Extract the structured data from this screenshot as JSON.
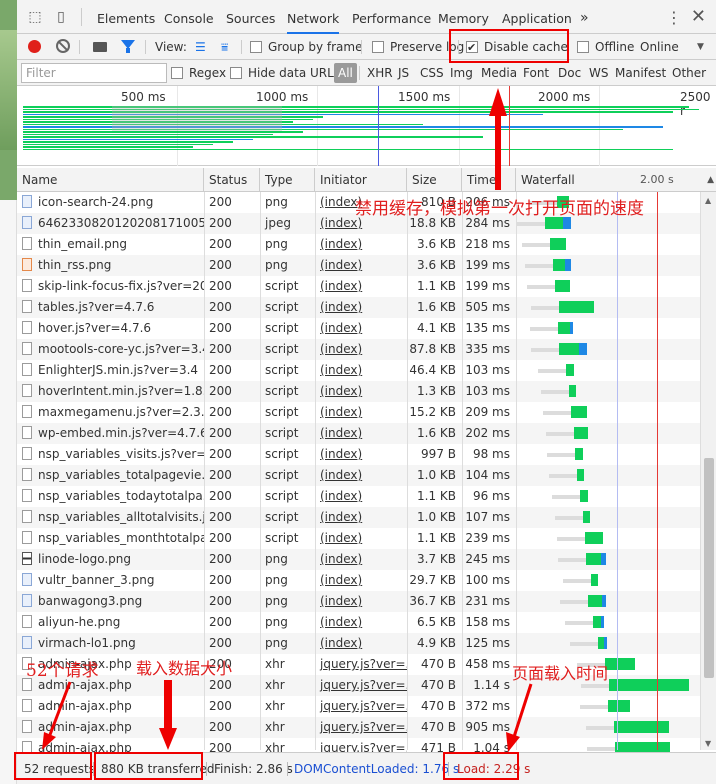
{
  "tabbar": {
    "tabs": [
      "Elements",
      "Console",
      "Sources",
      "Network",
      "Performance",
      "Memory",
      "Application"
    ],
    "active_tab": "Network",
    "more_icon": "»",
    "kebab_icon": "⋮",
    "close_icon": "✕"
  },
  "toolbar": {
    "view_label": "View:",
    "group_by_frame": "Group by frame",
    "preserve_log": "Preserve log",
    "disable_cache": "Disable cache",
    "offline": "Offline",
    "throttle": "Online"
  },
  "filterbar": {
    "filter_placeholder": "Filter",
    "regex": "Regex",
    "hide_data_urls": "Hide data URLs",
    "types": [
      "All",
      "XHR",
      "JS",
      "CSS",
      "Img",
      "Media",
      "Font",
      "Doc",
      "WS",
      "Manifest",
      "Other"
    ]
  },
  "overview": {
    "ticks": [
      "500 ms",
      "1000 ms",
      "1500 ms",
      "2000 ms",
      "2500 r"
    ]
  },
  "table": {
    "headers": [
      "Name",
      "Status",
      "Type",
      "Initiator",
      "Size",
      "Time",
      "Waterfall"
    ],
    "waterfall_tick": "2.00 s",
    "rows": [
      {
        "name": "icon-search-24.png",
        "status": "200",
        "type": "png",
        "initiator": "(index)",
        "size": "810 B",
        "time": "206 ms",
        "icon": "img"
      },
      {
        "name": "6462330820120208171005...",
        "status": "200",
        "type": "jpeg",
        "initiator": "(index)",
        "size": "18.8 KB",
        "time": "284 ms",
        "icon": "img"
      },
      {
        "name": "thin_email.png",
        "status": "200",
        "type": "png",
        "initiator": "(index)",
        "size": "3.6 KB",
        "time": "218 ms",
        "icon": "doc"
      },
      {
        "name": "thin_rss.png",
        "status": "200",
        "type": "png",
        "initiator": "(index)",
        "size": "3.6 KB",
        "time": "199 ms",
        "icon": "rss"
      },
      {
        "name": "skip-link-focus-fix.js?ver=20...",
        "status": "200",
        "type": "script",
        "initiator": "(index)",
        "size": "1.1 KB",
        "time": "199 ms",
        "icon": "doc"
      },
      {
        "name": "tables.js?ver=4.7.6",
        "status": "200",
        "type": "script",
        "initiator": "(index)",
        "size": "1.6 KB",
        "time": "505 ms",
        "icon": "doc"
      },
      {
        "name": "hover.js?ver=4.7.6",
        "status": "200",
        "type": "script",
        "initiator": "(index)",
        "size": "4.1 KB",
        "time": "135 ms",
        "icon": "doc"
      },
      {
        "name": "mootools-core-yc.js?ver=3.4",
        "status": "200",
        "type": "script",
        "initiator": "(index)",
        "size": "87.8 KB",
        "time": "335 ms",
        "icon": "doc"
      },
      {
        "name": "EnlighterJS.min.js?ver=3.4",
        "status": "200",
        "type": "script",
        "initiator": "(index)",
        "size": "46.4 KB",
        "time": "103 ms",
        "icon": "doc"
      },
      {
        "name": "hoverIntent.min.js?ver=1.8.1",
        "status": "200",
        "type": "script",
        "initiator": "(index)",
        "size": "1.3 KB",
        "time": "103 ms",
        "icon": "doc"
      },
      {
        "name": "maxmegamenu.js?ver=2.3.7.1",
        "status": "200",
        "type": "script",
        "initiator": "(index)",
        "size": "15.2 KB",
        "time": "209 ms",
        "icon": "doc"
      },
      {
        "name": "wp-embed.min.js?ver=4.7.6",
        "status": "200",
        "type": "script",
        "initiator": "(index)",
        "size": "1.6 KB",
        "time": "202 ms",
        "icon": "doc"
      },
      {
        "name": "nsp_variables_visits.js?ver=4...",
        "status": "200",
        "type": "script",
        "initiator": "(index)",
        "size": "997 B",
        "time": "98 ms",
        "icon": "doc"
      },
      {
        "name": "nsp_variables_totalpagevie...",
        "status": "200",
        "type": "script",
        "initiator": "(index)",
        "size": "1.0 KB",
        "time": "104 ms",
        "icon": "doc"
      },
      {
        "name": "nsp_variables_todaytotalpa...",
        "status": "200",
        "type": "script",
        "initiator": "(index)",
        "size": "1.1 KB",
        "time": "96 ms",
        "icon": "doc"
      },
      {
        "name": "nsp_variables_alltotalvisits.js...",
        "status": "200",
        "type": "script",
        "initiator": "(index)",
        "size": "1.0 KB",
        "time": "107 ms",
        "icon": "doc"
      },
      {
        "name": "nsp_variables_monthtotalpa...",
        "status": "200",
        "type": "script",
        "initiator": "(index)",
        "size": "1.1 KB",
        "time": "239 ms",
        "icon": "doc"
      },
      {
        "name": "linode-logo.png",
        "status": "200",
        "type": "png",
        "initiator": "(index)",
        "size": "3.7 KB",
        "time": "245 ms",
        "icon": "logo"
      },
      {
        "name": "vultr_banner_3.png",
        "status": "200",
        "type": "png",
        "initiator": "(index)",
        "size": "29.7 KB",
        "time": "100 ms",
        "icon": "img"
      },
      {
        "name": "banwagong3.png",
        "status": "200",
        "type": "png",
        "initiator": "(index)",
        "size": "36.7 KB",
        "time": "231 ms",
        "icon": "img"
      },
      {
        "name": "aliyun-he.png",
        "status": "200",
        "type": "png",
        "initiator": "(index)",
        "size": "6.5 KB",
        "time": "158 ms",
        "icon": "doc"
      },
      {
        "name": "virmach-lo1.png",
        "status": "200",
        "type": "png",
        "initiator": "(index)",
        "size": "4.9 KB",
        "time": "125 ms",
        "icon": "img"
      },
      {
        "name": "admin-ajax.php",
        "status": "200",
        "type": "xhr",
        "initiator": "jquery.js?ver=...",
        "size": "470 B",
        "time": "458 ms",
        "icon": "doc"
      },
      {
        "name": "admin-ajax.php",
        "status": "200",
        "type": "xhr",
        "initiator": "jquery.js?ver=...",
        "size": "470 B",
        "time": "1.14 s",
        "icon": "doc"
      },
      {
        "name": "admin-ajax.php",
        "status": "200",
        "type": "xhr",
        "initiator": "jquery.js?ver=...",
        "size": "470 B",
        "time": "372 ms",
        "icon": "doc"
      },
      {
        "name": "admin-ajax.php",
        "status": "200",
        "type": "xhr",
        "initiator": "jquery.js?ver=...",
        "size": "470 B",
        "time": "905 ms",
        "icon": "doc"
      },
      {
        "name": "admin-ajax.php",
        "status": "200",
        "type": "xhr",
        "initiator": "jquery.js?ver=...",
        "size": "471 B",
        "time": "1.04 s",
        "icon": "doc"
      }
    ]
  },
  "statusbar": {
    "requests": "52 requests",
    "transferred": "880 KB transferred",
    "finish": "Finish: 2.86 s",
    "dom_content_loaded": "DOMContentLoaded: 1.76 s",
    "load": "Load: 2.29 s"
  },
  "annotations": {
    "disable_cache_note": "禁用缓存，模拟第一次打开页面的速度",
    "requests_note": "52个请求",
    "transferred_note": "载入数据大小",
    "load_note": "页面载入时间"
  },
  "colors": {
    "annotation_red": "#e02020",
    "bar_green": "#0fcf5a",
    "bar_blue": "#1e88e5",
    "dcl_line": "#4a59e0",
    "load_line": "#e53935"
  }
}
